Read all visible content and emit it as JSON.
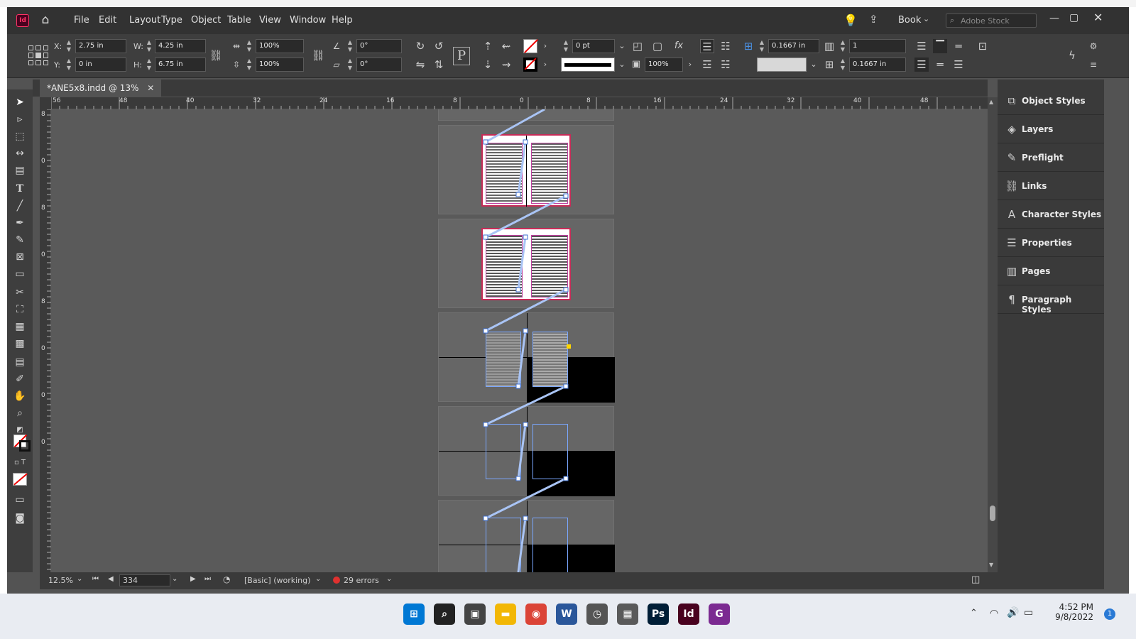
{
  "app": {
    "logo": "Id",
    "menu": [
      "File",
      "Edit",
      "Layout",
      "Type",
      "Object",
      "Table",
      "View",
      "Window",
      "Help"
    ],
    "workspace": "Book",
    "stock_placeholder": "Adobe Stock",
    "accent": "#ff3366"
  },
  "control": {
    "x_label": "X:",
    "x_value": "2.75 in",
    "y_label": "Y:",
    "y_value": "0 in",
    "w_label": "W:",
    "w_value": "4.25 in",
    "h_label": "H:",
    "h_value": "6.75 in",
    "scale_x": "100%",
    "scale_y": "100%",
    "rotate": "0°",
    "shear": "0°",
    "stroke_weight": "0 pt",
    "opacity": "100%",
    "gutter_1": "0.1667 in",
    "gutter_2": "0.1667 in",
    "columns": "1"
  },
  "document": {
    "tab_title": "*ANE5x8.indd @ 13%",
    "ruler_h": [
      "56",
      "48",
      "40",
      "32",
      "24",
      "16",
      "8",
      "0",
      "8",
      "16",
      "24",
      "32",
      "40",
      "48"
    ],
    "ruler_v": [
      "8",
      "0",
      "8",
      "0",
      "8",
      "0",
      "0",
      "0"
    ]
  },
  "status": {
    "zoom": "12.5%",
    "page": "334",
    "preflight_profile": "[Basic] (working)",
    "errors": "29 errors"
  },
  "panels": [
    {
      "label": "Object Styles",
      "icon": "object-styles-icon"
    },
    {
      "label": "Layers",
      "icon": "layers-icon"
    },
    {
      "label": "Preflight",
      "icon": "preflight-icon"
    },
    {
      "label": "Links",
      "icon": "links-icon"
    },
    {
      "label": "Character Styles",
      "icon": "character-styles-icon"
    },
    {
      "label": "Properties",
      "icon": "properties-icon"
    },
    {
      "label": "Pages",
      "icon": "pages-icon"
    },
    {
      "label": "Paragraph Styles",
      "icon": "paragraph-styles-icon"
    }
  ],
  "taskbar": {
    "time": "4:52 PM",
    "date": "9/8/2022",
    "notifications": "1",
    "apps": [
      {
        "name": "start",
        "glyph": "⊞",
        "color": "#0078d4"
      },
      {
        "name": "search",
        "glyph": "⌕",
        "color": "#222222"
      },
      {
        "name": "task-view",
        "glyph": "▣",
        "color": "#444444"
      },
      {
        "name": "file-explorer",
        "glyph": "▬",
        "color": "#f2b705"
      },
      {
        "name": "chrome",
        "glyph": "◉",
        "color": "#db4437"
      },
      {
        "name": "word",
        "glyph": "W",
        "color": "#2b579a"
      },
      {
        "name": "clock-app",
        "glyph": "◷",
        "color": "#555555"
      },
      {
        "name": "calculator",
        "glyph": "▦",
        "color": "#5a5a5a"
      },
      {
        "name": "photoshop",
        "glyph": "Ps",
        "color": "#001e36"
      },
      {
        "name": "indesign",
        "glyph": "Id",
        "color": "#49021f"
      },
      {
        "name": "pdf-app",
        "glyph": "G",
        "color": "#7b2a91"
      }
    ]
  }
}
